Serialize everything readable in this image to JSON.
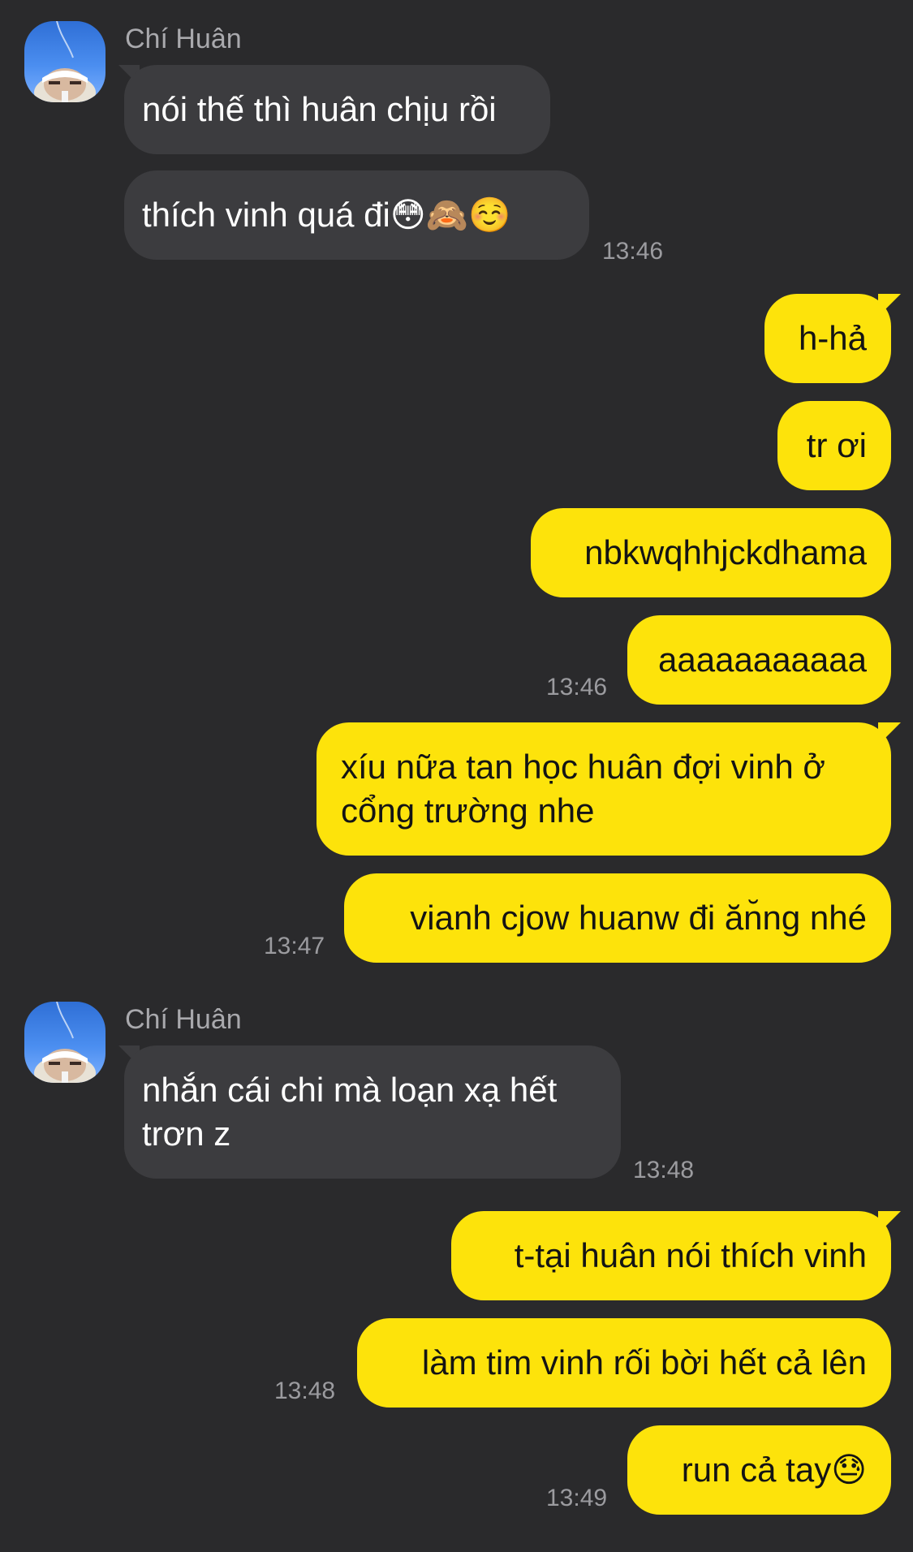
{
  "contact": {
    "name": "Chí Huân",
    "avatar_icon": "user-avatar-icon"
  },
  "colors": {
    "background": "#2a2a2c",
    "incoming_bubble": "#3c3c3f",
    "outgoing_bubble": "#fde30b",
    "timestamp": "#9b9b9f"
  },
  "messages": [
    {
      "from": "Chí Huân",
      "text": "nói thế thì huân chịu rồi"
    },
    {
      "from": "Chí Huân",
      "text": "thích vinh quá đi😳🙈☺️",
      "time": "13:46"
    },
    {
      "from": "me",
      "text": "h-hả"
    },
    {
      "from": "me",
      "text": "tr ơi"
    },
    {
      "from": "me",
      "text": "nbkwqhhjckdhama"
    },
    {
      "from": "me",
      "text": "aaaaaaaaaaa",
      "time": "13:46"
    },
    {
      "from": "me",
      "lines": [
        "xíu nữa tan học huân đợi vinh ở",
        "cổng trường nhe"
      ]
    },
    {
      "from": "me",
      "text": "vianh cjow huanw đi ăn̆ng nhé",
      "time": "13:47"
    },
    {
      "from": "Chí Huân",
      "lines": [
        "nhắn cái chi mà loạn xạ hết",
        "trơn z"
      ],
      "time": "13:48"
    },
    {
      "from": "me",
      "text": "t-tại huân nói thích vinh"
    },
    {
      "from": "me",
      "text": "làm tim vinh rối bời hết cả lên",
      "time": "13:48"
    },
    {
      "from": "me",
      "text": "run cả tay😓",
      "time": "13:49"
    }
  ]
}
